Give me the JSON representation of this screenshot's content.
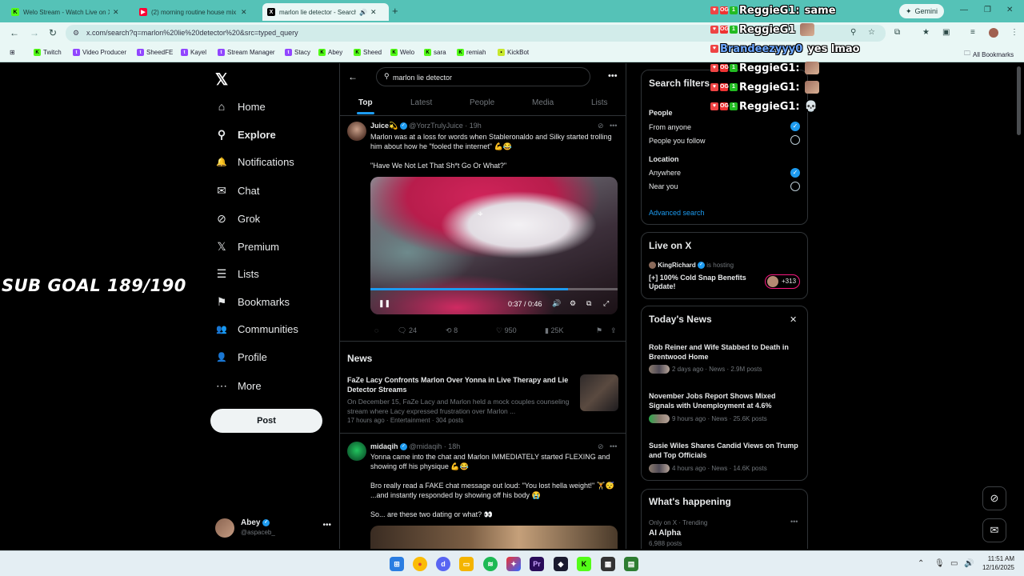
{
  "browser": {
    "tabs": [
      {
        "title": "Welo Stream - Watch Live on X",
        "active": false
      },
      {
        "title": "(2) morning routine house mix",
        "active": false
      },
      {
        "title": "marlon lie detector - Search",
        "active": true
      }
    ],
    "gemini_label": "Gemini",
    "url": "x.com/search?q=marlon%20lie%20detector%20&src=typed_query",
    "bookmarks": [
      "Twitch",
      "Video Producer",
      "SheedFE",
      "Kayel",
      "Stream Manager",
      "Stacy",
      "Abey",
      "Sheed",
      "Welo",
      "sara",
      "remiah",
      "KickBot"
    ],
    "all_bookmarks": "All Bookmarks"
  },
  "nav": {
    "items": [
      {
        "label": "Home",
        "icon": "home-icon",
        "glyph": "⌂"
      },
      {
        "label": "Explore",
        "icon": "search-icon",
        "glyph": "⚲"
      },
      {
        "label": "Notifications",
        "icon": "bell-icon",
        "glyph": "🔔"
      },
      {
        "label": "Chat",
        "icon": "mail-icon",
        "glyph": "✉"
      },
      {
        "label": "Grok",
        "icon": "grok-icon",
        "glyph": "⊘"
      },
      {
        "label": "Premium",
        "icon": "x-icon",
        "glyph": "𝕏"
      },
      {
        "label": "Lists",
        "icon": "list-icon",
        "glyph": "☰"
      },
      {
        "label": "Bookmarks",
        "icon": "bookmark-icon",
        "glyph": "⚑"
      },
      {
        "label": "Communities",
        "icon": "people-icon",
        "glyph": "👥"
      },
      {
        "label": "Profile",
        "icon": "person-icon",
        "glyph": "👤"
      },
      {
        "label": "More",
        "icon": "more-icon",
        "glyph": "⋯"
      }
    ],
    "post_label": "Post",
    "account": {
      "name": "Abey",
      "handle": "@aspaceb_"
    }
  },
  "search": {
    "query": "marlon lie detector",
    "tabs": [
      "Top",
      "Latest",
      "People",
      "Media",
      "Lists"
    ]
  },
  "tweet1": {
    "name": "Juice💫",
    "handle": "@YorzTrulyJuice",
    "time": "· 19h",
    "text1": "Marlon was at a loss for words when Stableronaldo and Silky started trolling him about how he \"fooled the internet\" 💪😂",
    "text2": "\"Have We Not Let That Sh*t Go Or What?\"",
    "video_time": "0:37 / 0:46",
    "video_progress": 0.8,
    "replies": "24",
    "reposts": "8",
    "likes": "950",
    "views": "25K"
  },
  "news_section": {
    "title": "News",
    "headline": "FaZe Lacy Confronts Marlon Over Yonna in Live Therapy and Lie Detector Streams",
    "summary": "On December 15, FaZe Lacy and Marlon held a mock couples counseling stream where Lacy expressed frustration over Marlon ...",
    "meta": "17 hours ago · Entertainment · 304 posts"
  },
  "tweet2": {
    "name": "midaqih",
    "handle": "@midaqih",
    "time": "· 18h",
    "text1": "Yonna came into the chat and Marlon IMMEDIATELY started FLEXING and showing off his physique 💪😂",
    "text2": "Bro really read a FAKE chat message out loud: \"You lost hella weight!\" 🏋️😴 ...and instantly responded by showing off his body 😭",
    "text3": "So... are these two dating or what? 👀"
  },
  "filters": {
    "title": "Search filters",
    "people_label": "People",
    "people_opts": [
      "From anyone",
      "People you follow"
    ],
    "location_label": "Location",
    "location_opts": [
      "Anywhere",
      "Near you"
    ],
    "advanced": "Advanced search"
  },
  "live": {
    "title": "Live on X",
    "host": "KingRichard",
    "hosting": "is hosting",
    "stream_title": "[+] 100% Cold Snap Benefits Update!",
    "count": "+313"
  },
  "today_news": {
    "title": "Today's News",
    "items": [
      {
        "headline": "Rob Reiner and Wife Stabbed to Death in Brentwood Home",
        "meta": "2 days ago · News · 2.9M posts"
      },
      {
        "headline": "November Jobs Report Shows Mixed Signals with Unemployment at 4.6%",
        "meta": "9 hours ago · News · 25.6K posts"
      },
      {
        "headline": "Susie Wiles Shares Candid Views on Trump and Top Officials",
        "meta": "4 hours ago · News · 14.6K posts"
      }
    ]
  },
  "happening": {
    "title": "What's happening",
    "context": "Only on X · Trending",
    "topic": "AI Alpha",
    "posts": "6,988 posts"
  },
  "overlay": {
    "sub_goal": "SUB GOAL 189/190",
    "chat": [
      {
        "user": "ReggieG1:",
        "msg": "same",
        "emote": false
      },
      {
        "user": "ReggieG1",
        "msg": "",
        "emote": true
      },
      {
        "user": "Brandeezyyy0",
        "msg": "yes lmao",
        "emote": false
      },
      {
        "user": "ReggieG1:",
        "msg": "",
        "emote": true
      },
      {
        "user": "ReggieG1:",
        "msg": "",
        "emote": true
      },
      {
        "user": "ReggieG1:",
        "msg": "💀",
        "emote": false
      }
    ]
  },
  "clock": {
    "time": "11:51 AM",
    "date": "12/16/2025"
  }
}
